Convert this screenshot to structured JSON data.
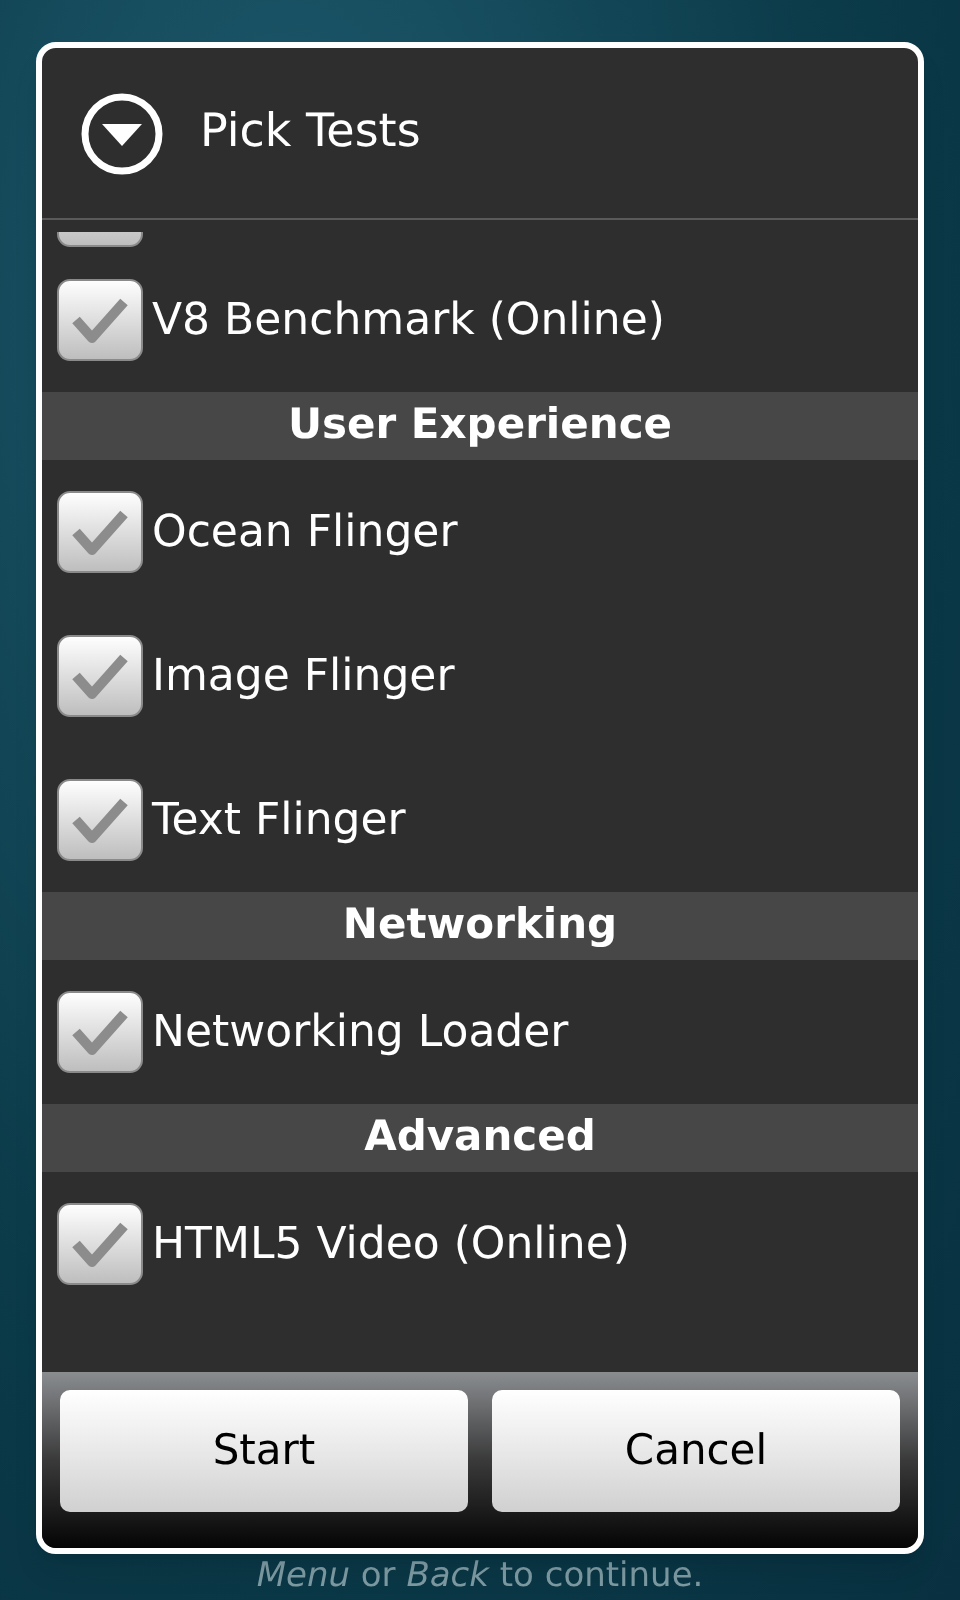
{
  "background": {
    "hint": "*Menu* or *Back* to continue."
  },
  "dialog": {
    "title": "Pick Tests",
    "list": [
      {
        "kind": "partial"
      },
      {
        "kind": "item",
        "label": "V8 Benchmark (Online)",
        "checked": true
      },
      {
        "kind": "header",
        "label": "User Experience"
      },
      {
        "kind": "item",
        "label": "Ocean Flinger",
        "checked": true
      },
      {
        "kind": "item",
        "label": "Image Flinger",
        "checked": true
      },
      {
        "kind": "item",
        "label": "Text Flinger",
        "checked": true
      },
      {
        "kind": "header",
        "label": "Networking"
      },
      {
        "kind": "item",
        "label": "Networking Loader",
        "checked": true
      },
      {
        "kind": "header",
        "label": "Advanced"
      },
      {
        "kind": "item",
        "label": "HTML5 Video (Online)",
        "checked": true
      }
    ],
    "buttons": [
      "Start",
      "Cancel"
    ]
  }
}
